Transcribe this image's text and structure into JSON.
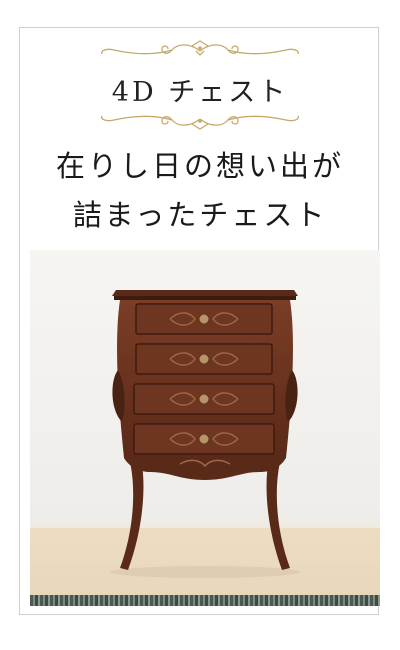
{
  "subtitle": "4D チェスト",
  "headline": {
    "line1": "在りし日の想い出が",
    "line2": "詰まったチェスト"
  },
  "colors": {
    "ornament": "#c8a96a",
    "wood": "#6a3320",
    "wood_dark": "#3e1a0f",
    "background": "#f4f3f0"
  }
}
